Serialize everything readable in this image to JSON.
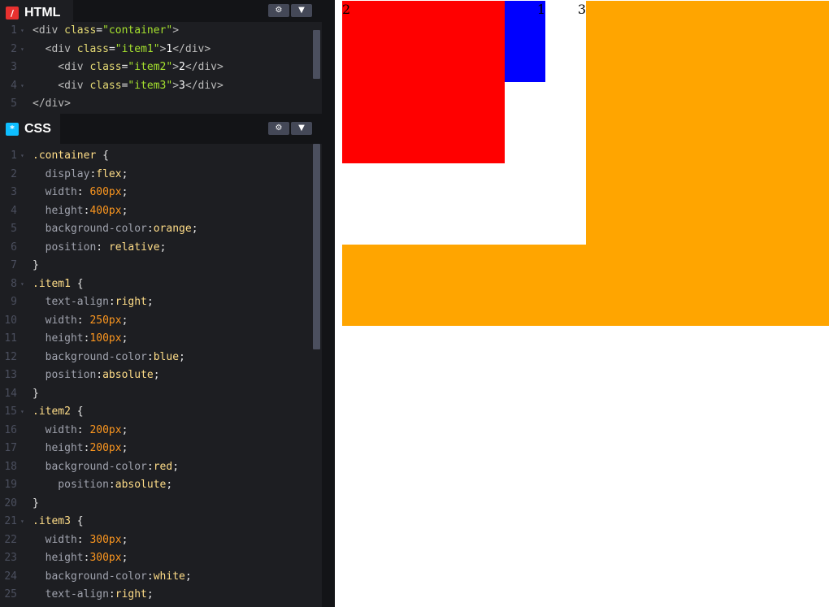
{
  "html_panel": {
    "tab_label": "HTML",
    "tab_icon": "/",
    "icon_color": "#e8312f",
    "settings_icon": "gear-icon",
    "collapse_icon": "chevron-down-icon",
    "lines": [
      {
        "num": "1",
        "fold": "▾",
        "tokens": [
          {
            "t": "<div ",
            "c": "tag"
          },
          {
            "t": "class",
            "c": "attr"
          },
          {
            "t": "=",
            "c": "punct"
          },
          {
            "t": "\"container\"",
            "c": "str"
          },
          {
            "t": ">",
            "c": "tag"
          }
        ]
      },
      {
        "num": "2",
        "fold": "▾",
        "tokens": [
          {
            "t": "  <div ",
            "c": "tag"
          },
          {
            "t": "class",
            "c": "attr"
          },
          {
            "t": "=",
            "c": "punct"
          },
          {
            "t": "\"item1\"",
            "c": "str"
          },
          {
            "t": ">",
            "c": "tag"
          },
          {
            "t": "1",
            "c": "txt"
          },
          {
            "t": "</div>",
            "c": "tag"
          }
        ]
      },
      {
        "num": "3",
        "fold": "",
        "tokens": [
          {
            "t": "    <div ",
            "c": "tag"
          },
          {
            "t": "class",
            "c": "attr"
          },
          {
            "t": "=",
            "c": "punct"
          },
          {
            "t": "\"item2\"",
            "c": "str"
          },
          {
            "t": ">",
            "c": "tag"
          },
          {
            "t": "2",
            "c": "txt"
          },
          {
            "t": "</div>",
            "c": "tag"
          }
        ]
      },
      {
        "num": "4",
        "fold": "▾",
        "tokens": [
          {
            "t": "    <div ",
            "c": "tag"
          },
          {
            "t": "class",
            "c": "attr"
          },
          {
            "t": "=",
            "c": "punct"
          },
          {
            "t": "\"item3\"",
            "c": "str"
          },
          {
            "t": ">",
            "c": "tag"
          },
          {
            "t": "3",
            "c": "txt"
          },
          {
            "t": "</div>",
            "c": "tag"
          }
        ]
      },
      {
        "num": "5",
        "fold": "",
        "tokens": [
          {
            "t": "</div>",
            "c": "tag"
          }
        ]
      }
    ]
  },
  "css_panel": {
    "tab_label": "CSS",
    "tab_icon": "*",
    "icon_color": "#0ebeff",
    "settings_icon": "gear-icon",
    "collapse_icon": "chevron-down-icon",
    "lines": [
      {
        "num": "1",
        "fold": "▾",
        "tokens": [
          {
            "t": ".container",
            "c": "sel"
          },
          {
            "t": " {",
            "c": "punct"
          }
        ]
      },
      {
        "num": "2",
        "fold": "",
        "tokens": [
          {
            "t": "  display",
            "c": "prop"
          },
          {
            "t": ":",
            "c": "punct"
          },
          {
            "t": "flex",
            "c": "val"
          },
          {
            "t": ";",
            "c": "punct"
          }
        ]
      },
      {
        "num": "3",
        "fold": "",
        "tokens": [
          {
            "t": "  width",
            "c": "prop"
          },
          {
            "t": ": ",
            "c": "punct"
          },
          {
            "t": "600px",
            "c": "num"
          },
          {
            "t": ";",
            "c": "punct"
          }
        ]
      },
      {
        "num": "4",
        "fold": "",
        "tokens": [
          {
            "t": "  height",
            "c": "prop"
          },
          {
            "t": ":",
            "c": "punct"
          },
          {
            "t": "400px",
            "c": "num"
          },
          {
            "t": ";",
            "c": "punct"
          }
        ]
      },
      {
        "num": "5",
        "fold": "",
        "tokens": [
          {
            "t": "  background-color",
            "c": "prop"
          },
          {
            "t": ":",
            "c": "punct"
          },
          {
            "t": "orange",
            "c": "val"
          },
          {
            "t": ";",
            "c": "punct"
          }
        ]
      },
      {
        "num": "6",
        "fold": "",
        "tokens": [
          {
            "t": "  position",
            "c": "prop"
          },
          {
            "t": ": ",
            "c": "punct"
          },
          {
            "t": "relative",
            "c": "val"
          },
          {
            "t": ";",
            "c": "punct"
          }
        ]
      },
      {
        "num": "7",
        "fold": "",
        "tokens": [
          {
            "t": "}",
            "c": "punct"
          }
        ]
      },
      {
        "num": "8",
        "fold": "▾",
        "tokens": [
          {
            "t": ".item1",
            "c": "sel"
          },
          {
            "t": " {",
            "c": "punct"
          }
        ]
      },
      {
        "num": "9",
        "fold": "",
        "tokens": [
          {
            "t": "  text-align",
            "c": "prop"
          },
          {
            "t": ":",
            "c": "punct"
          },
          {
            "t": "right",
            "c": "val"
          },
          {
            "t": ";",
            "c": "punct"
          }
        ]
      },
      {
        "num": "10",
        "fold": "",
        "tokens": [
          {
            "t": "  width",
            "c": "prop"
          },
          {
            "t": ": ",
            "c": "punct"
          },
          {
            "t": "250px",
            "c": "num"
          },
          {
            "t": ";",
            "c": "punct"
          }
        ]
      },
      {
        "num": "11",
        "fold": "",
        "tokens": [
          {
            "t": "  height",
            "c": "prop"
          },
          {
            "t": ":",
            "c": "punct"
          },
          {
            "t": "100px",
            "c": "num"
          },
          {
            "t": ";",
            "c": "punct"
          }
        ]
      },
      {
        "num": "12",
        "fold": "",
        "tokens": [
          {
            "t": "  background-color",
            "c": "prop"
          },
          {
            "t": ":",
            "c": "punct"
          },
          {
            "t": "blue",
            "c": "val"
          },
          {
            "t": ";",
            "c": "punct"
          }
        ]
      },
      {
        "num": "13",
        "fold": "",
        "tokens": [
          {
            "t": "  position",
            "c": "prop"
          },
          {
            "t": ":",
            "c": "punct"
          },
          {
            "t": "absolute",
            "c": "val"
          },
          {
            "t": ";",
            "c": "punct"
          }
        ]
      },
      {
        "num": "14",
        "fold": "",
        "tokens": [
          {
            "t": "}",
            "c": "punct"
          }
        ]
      },
      {
        "num": "15",
        "fold": "▾",
        "tokens": [
          {
            "t": ".item2",
            "c": "sel"
          },
          {
            "t": " {",
            "c": "punct"
          }
        ]
      },
      {
        "num": "16",
        "fold": "",
        "tokens": [
          {
            "t": "  width",
            "c": "prop"
          },
          {
            "t": ": ",
            "c": "punct"
          },
          {
            "t": "200px",
            "c": "num"
          },
          {
            "t": ";",
            "c": "punct"
          }
        ]
      },
      {
        "num": "17",
        "fold": "",
        "tokens": [
          {
            "t": "  height",
            "c": "prop"
          },
          {
            "t": ":",
            "c": "punct"
          },
          {
            "t": "200px",
            "c": "num"
          },
          {
            "t": ";",
            "c": "punct"
          }
        ]
      },
      {
        "num": "18",
        "fold": "",
        "tokens": [
          {
            "t": "  background-color",
            "c": "prop"
          },
          {
            "t": ":",
            "c": "punct"
          },
          {
            "t": "red",
            "c": "val"
          },
          {
            "t": ";",
            "c": "punct"
          }
        ]
      },
      {
        "num": "19",
        "fold": "",
        "tokens": [
          {
            "t": "    position",
            "c": "prop"
          },
          {
            "t": ":",
            "c": "punct"
          },
          {
            "t": "absolute",
            "c": "val"
          },
          {
            "t": ";",
            "c": "punct"
          }
        ]
      },
      {
        "num": "20",
        "fold": "",
        "tokens": [
          {
            "t": "}",
            "c": "punct"
          }
        ]
      },
      {
        "num": "21",
        "fold": "▾",
        "tokens": [
          {
            "t": ".item3",
            "c": "sel"
          },
          {
            "t": " {",
            "c": "punct"
          }
        ]
      },
      {
        "num": "22",
        "fold": "",
        "tokens": [
          {
            "t": "  width",
            "c": "prop"
          },
          {
            "t": ": ",
            "c": "punct"
          },
          {
            "t": "300px",
            "c": "num"
          },
          {
            "t": ";",
            "c": "punct"
          }
        ]
      },
      {
        "num": "23",
        "fold": "",
        "tokens": [
          {
            "t": "  height",
            "c": "prop"
          },
          {
            "t": ":",
            "c": "punct"
          },
          {
            "t": "300px",
            "c": "num"
          },
          {
            "t": ";",
            "c": "punct"
          }
        ]
      },
      {
        "num": "24",
        "fold": "",
        "tokens": [
          {
            "t": "  background-color",
            "c": "prop"
          },
          {
            "t": ":",
            "c": "punct"
          },
          {
            "t": "white",
            "c": "val"
          },
          {
            "t": ";",
            "c": "punct"
          }
        ]
      },
      {
        "num": "25",
        "fold": "",
        "tokens": [
          {
            "t": "  text-align",
            "c": "prop"
          },
          {
            "t": ":",
            "c": "punct"
          },
          {
            "t": "right",
            "c": "val"
          },
          {
            "t": ";",
            "c": "punct"
          }
        ]
      }
    ]
  },
  "preview": {
    "container_color": "#ffa500",
    "item1": {
      "text": "1",
      "color": "#0000ff"
    },
    "item2": {
      "text": "2",
      "color": "#ff0000"
    },
    "item3": {
      "text": "3",
      "color": "#ffffff"
    }
  }
}
